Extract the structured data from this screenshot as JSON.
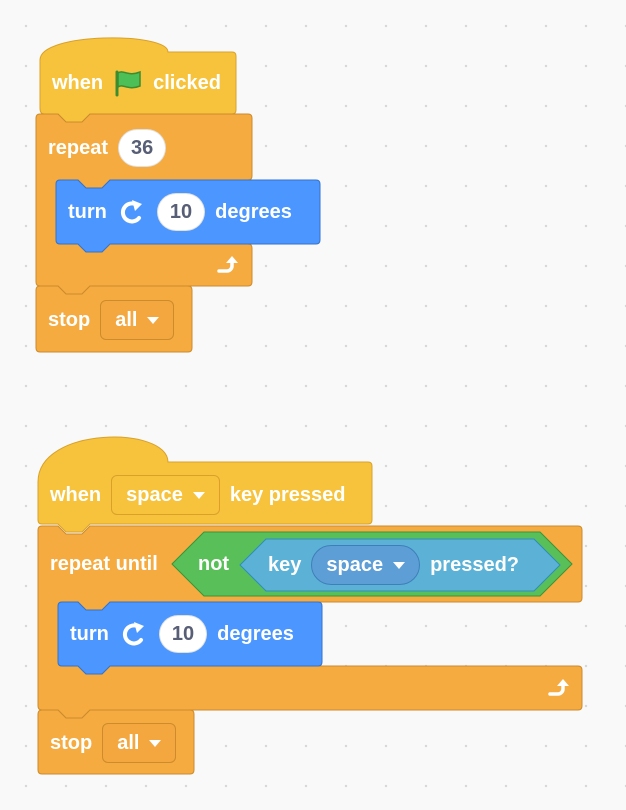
{
  "colors": {
    "events": "#f7c33c",
    "events_border": "#d9a12a",
    "control": "#f5ab40",
    "control_border": "#cc8b2c",
    "motion": "#4c97ff",
    "motion_border": "#3373cc",
    "operators": "#59c059",
    "operators_border": "#389438",
    "sensing": "#5cb1d6",
    "sensing_border": "#2e8eb8",
    "canvas": "#f9f9f9"
  },
  "scripts": [
    {
      "hat": {
        "when_label": "when",
        "icon": "green-flag-icon",
        "clicked_label": "clicked"
      },
      "repeat": {
        "label": "repeat",
        "count": "36"
      },
      "turn": {
        "label": "turn",
        "icon": "rotate-clockwise-icon",
        "degrees": "10",
        "degrees_label": "degrees"
      },
      "loop_end_icon": "loop-arrow-icon",
      "stop": {
        "label": "stop",
        "option": "all"
      }
    },
    {
      "hat": {
        "when_label": "when",
        "key": "space",
        "key_pressed_label": "key pressed"
      },
      "repeat_until": {
        "label": "repeat until",
        "not_label": "not",
        "key_label": "key",
        "key": "space",
        "pressed_label": "pressed?"
      },
      "turn": {
        "label": "turn",
        "icon": "rotate-clockwise-icon",
        "degrees": "10",
        "degrees_label": "degrees"
      },
      "loop_end_icon": "loop-arrow-icon",
      "stop": {
        "label": "stop",
        "option": "all"
      }
    }
  ]
}
